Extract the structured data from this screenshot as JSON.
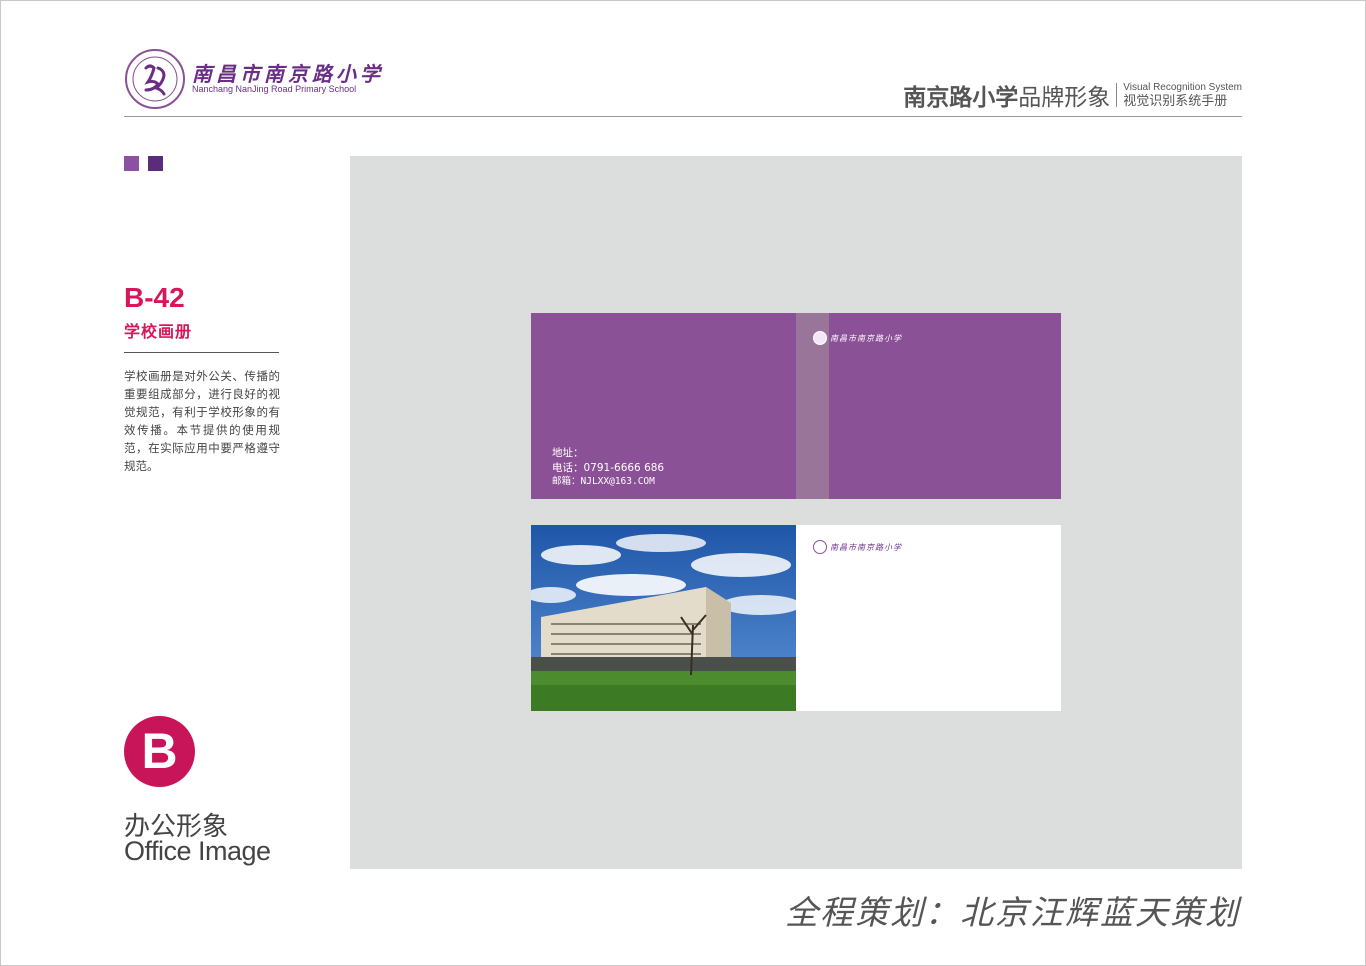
{
  "header": {
    "logo": {
      "name_cn": "南昌市南京路小学",
      "name_en": "Nanchang NanJing Road Primary School"
    },
    "title_bold": "南京路小学",
    "title_rest": "品牌形象",
    "subtitle_en": "Visual Recognition System",
    "subtitle_cn": "视觉识别系统手册"
  },
  "section": {
    "code": "B-42",
    "title": "学校画册",
    "description": "学校画册是对外公关、传播的重要组成部分，进行良好的视觉规范，有利于学校形象的有效传播。本节提供的使用规范，在实际应用中要严格遵守规范。"
  },
  "category": {
    "letter": "B",
    "name_cn": "办公形象",
    "name_en": "Office Image"
  },
  "brochure": {
    "cover": {
      "address_label": "地址：",
      "phone": "电话：0791-6666 686",
      "email": "邮箱：NJLXX@163.COM"
    }
  },
  "footer": {
    "text": "全程策划：北京汪辉蓝天策划"
  },
  "colors": {
    "brand_purple": "#8b5196",
    "accent_red": "#d6185b",
    "preview_bg": "#dcdddd"
  }
}
